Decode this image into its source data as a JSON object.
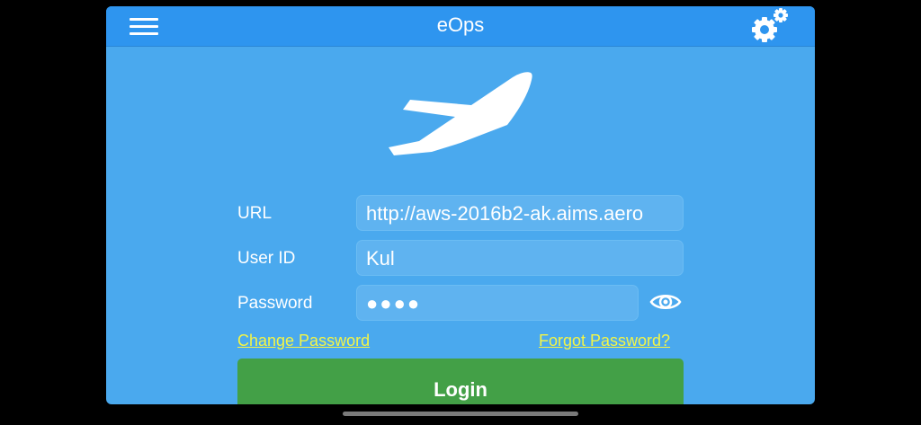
{
  "header": {
    "title": "eOps",
    "menu_icon": "hamburger-menu-icon",
    "settings_icon": "gears-icon"
  },
  "logo": {
    "icon": "airplane-icon"
  },
  "form": {
    "url_label": "URL",
    "url_value": "http://aws-2016b2-ak.aims.aero",
    "userid_label": "User ID",
    "userid_value": "Kul",
    "password_label": "Password",
    "password_value": "●●●●",
    "show_password_icon": "eye-icon"
  },
  "links": {
    "change_password": "Change Password",
    "forgot_password": "Forgot Password?"
  },
  "actions": {
    "login_label": "Login"
  },
  "colors": {
    "background": "#4aa9ee",
    "header": "#2e95ef",
    "link": "#f4f545",
    "login_button": "#43a047"
  }
}
